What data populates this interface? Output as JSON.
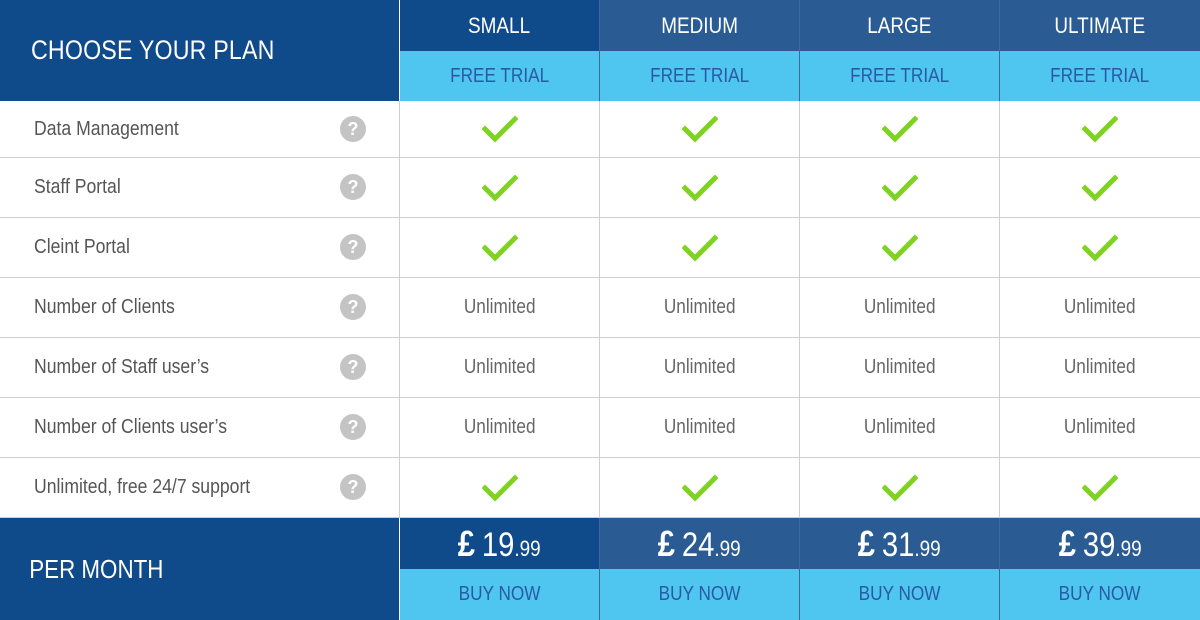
{
  "header": {
    "title": "CHOOSE YOUR PLAN",
    "trial_label": "FREE TRIAL"
  },
  "colors": {
    "dark_blue": "#0f4a8a",
    "plan_blue": "#2a5c93",
    "light_blue": "#4fc6ef",
    "check_green": "#7ed321"
  },
  "plans": [
    {
      "name": "SMALL",
      "price_whole": "19",
      "price_cents": ".99"
    },
    {
      "name": "MEDIUM",
      "price_whole": "24",
      "price_cents": ".99"
    },
    {
      "name": "LARGE",
      "price_whole": "31",
      "price_cents": ".99"
    },
    {
      "name": "ULTIMATE",
      "price_whole": "39",
      "price_cents": ".99"
    }
  ],
  "features": [
    {
      "label": "Data Management",
      "values": [
        "check",
        "check",
        "check",
        "check"
      ]
    },
    {
      "label": "Staff Portal",
      "values": [
        "check",
        "check",
        "check",
        "check"
      ]
    },
    {
      "label": "Cleint Portal",
      "values": [
        "check",
        "check",
        "check",
        "check"
      ]
    },
    {
      "label": "Number of Clients",
      "values": [
        "Unlimited",
        "Unlimited",
        "Unlimited",
        "Unlimited"
      ]
    },
    {
      "label": "Number of Staff user’s",
      "values": [
        "Unlimited",
        "Unlimited",
        "Unlimited",
        "Unlimited"
      ]
    },
    {
      "label": "Number of Clients user’s",
      "values": [
        "Unlimited",
        "Unlimited",
        "Unlimited",
        "Unlimited"
      ]
    },
    {
      "label": "Unlimited, free 24/7 support",
      "values": [
        "check",
        "check",
        "check",
        "check"
      ]
    }
  ],
  "help_icon": {
    "icon": "question-circle-icon",
    "glyph": "?"
  },
  "footer": {
    "title": "PER MONTH",
    "currency": "£",
    "buy_label": "BUY NOW"
  }
}
